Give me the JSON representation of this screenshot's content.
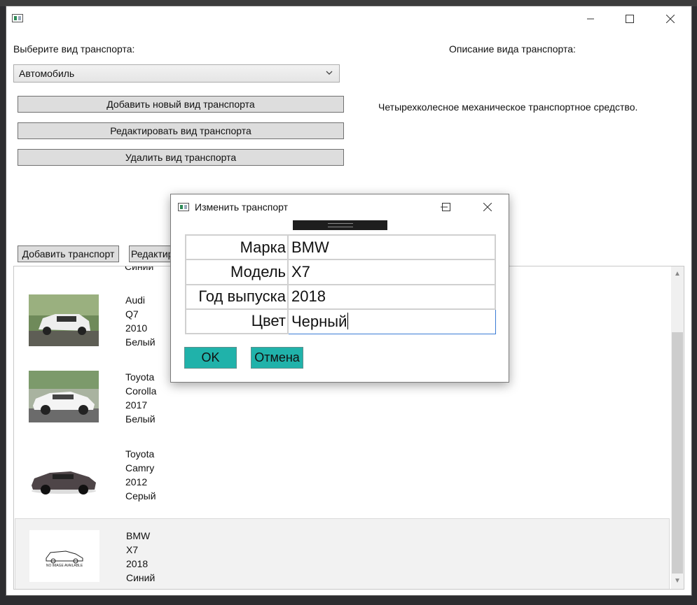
{
  "window": {
    "controls": {
      "minimize": "–",
      "maximize": "☐",
      "close": "✕"
    }
  },
  "transport_type": {
    "label": "Выберите вид транспорта:",
    "selected": "Автомобиль",
    "description_label": "Описание вида транспорта:",
    "description": "Четырехколесное механическое транспортное средство."
  },
  "type_buttons": {
    "add": "Добавить новый вид транспорта",
    "edit": "Редактировать вид транспорта",
    "delete": "Удалить вид транспорта"
  },
  "vehicle_buttons": {
    "add": "Добавить транспорт",
    "edit": "Редактир"
  },
  "vehicles": [
    {
      "partial": "Синий"
    },
    {
      "brand": "Audi",
      "model": "Q7",
      "year": "2010",
      "color": "Белый"
    },
    {
      "brand": "Toyota",
      "model": "Corolla",
      "year": "2017",
      "color": "Белый"
    },
    {
      "brand": "Toyota",
      "model": "Camry",
      "year": "2012",
      "color": "Серый"
    },
    {
      "brand": "BMW",
      "model": "X7",
      "year": "2018",
      "color": "Синий",
      "image_text": "NO IMAGE AVAILABLE"
    }
  ],
  "dialog": {
    "title": "Изменить транспорт",
    "fields": [
      {
        "label": "Марка",
        "value": "BMW"
      },
      {
        "label": "Модель",
        "value": "X7"
      },
      {
        "label": "Год выпуска",
        "value": "2018"
      },
      {
        "label": "Цвет",
        "value": "Черный"
      }
    ],
    "ok": "OK",
    "cancel": "Отмена"
  },
  "colors": {
    "accent_button": "#20b2aa",
    "focus_border": "#3a7bd5"
  }
}
